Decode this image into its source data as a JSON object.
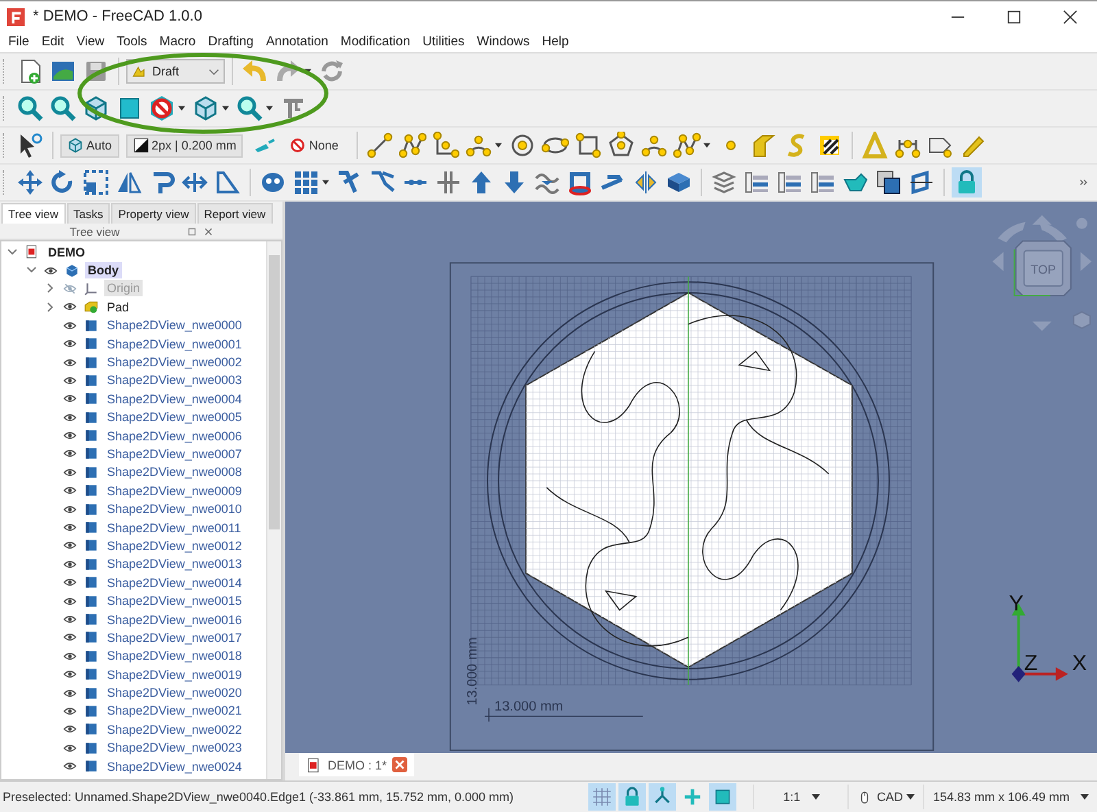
{
  "window": {
    "title": "* DEMO - FreeCAD 1.0.0"
  },
  "menu": [
    "File",
    "Edit",
    "View",
    "Tools",
    "Macro",
    "Drafting",
    "Annotation",
    "Modification",
    "Utilities",
    "Windows",
    "Help"
  ],
  "workbench": {
    "value": "Draft"
  },
  "draft_tray": {
    "construction": "Auto",
    "line_style": "2px | 0.200 mm",
    "autogroup": "None"
  },
  "lock_button": {
    "on": true
  },
  "panel": {
    "tabs": [
      {
        "label": "Tree view",
        "selected": true
      },
      {
        "label": "Tasks",
        "selected": false
      },
      {
        "label": "Property view",
        "selected": false
      },
      {
        "label": "Report view",
        "selected": false
      }
    ],
    "header": "Tree view"
  },
  "tree": {
    "items": [
      {
        "label": "DEMO",
        "kind": "document",
        "selected": false,
        "expanded": true,
        "children": [
          {
            "label": "Body",
            "kind": "body",
            "selected": true,
            "visible": true,
            "expanded": true,
            "children": [
              {
                "label": "Origin",
                "kind": "origin",
                "selected": false,
                "visible": false,
                "expanded": false
              },
              {
                "label": "Pad",
                "kind": "pad",
                "selected": false,
                "visible": true,
                "expanded": false
              },
              {
                "label": "Shape2DView_nwe0000",
                "kind": "shape",
                "selected": false,
                "visible": true
              },
              {
                "label": "Shape2DView_nwe0001",
                "kind": "shape",
                "selected": false,
                "visible": true
              },
              {
                "label": "Shape2DView_nwe0002",
                "kind": "shape",
                "selected": false,
                "visible": true
              },
              {
                "label": "Shape2DView_nwe0003",
                "kind": "shape",
                "selected": false,
                "visible": true
              },
              {
                "label": "Shape2DView_nwe0004",
                "kind": "shape",
                "selected": false,
                "visible": true
              },
              {
                "label": "Shape2DView_nwe0005",
                "kind": "shape",
                "selected": false,
                "visible": true
              },
              {
                "label": "Shape2DView_nwe0006",
                "kind": "shape",
                "selected": false,
                "visible": true
              },
              {
                "label": "Shape2DView_nwe0007",
                "kind": "shape",
                "selected": false,
                "visible": true
              },
              {
                "label": "Shape2DView_nwe0008",
                "kind": "shape",
                "selected": false,
                "visible": true
              },
              {
                "label": "Shape2DView_nwe0009",
                "kind": "shape",
                "selected": false,
                "visible": true
              },
              {
                "label": "Shape2DView_nwe0010",
                "kind": "shape",
                "selected": false,
                "visible": true
              },
              {
                "label": "Shape2DView_nwe0011",
                "kind": "shape",
                "selected": false,
                "visible": true
              },
              {
                "label": "Shape2DView_nwe0012",
                "kind": "shape",
                "selected": false,
                "visible": true
              },
              {
                "label": "Shape2DView_nwe0013",
                "kind": "shape",
                "selected": false,
                "visible": true
              },
              {
                "label": "Shape2DView_nwe0014",
                "kind": "shape",
                "selected": false,
                "visible": true
              },
              {
                "label": "Shape2DView_nwe0015",
                "kind": "shape",
                "selected": false,
                "visible": true
              },
              {
                "label": "Shape2DView_nwe0016",
                "kind": "shape",
                "selected": false,
                "visible": true
              },
              {
                "label": "Shape2DView_nwe0017",
                "kind": "shape",
                "selected": false,
                "visible": true
              },
              {
                "label": "Shape2DView_nwe0018",
                "kind": "shape",
                "selected": false,
                "visible": true
              },
              {
                "label": "Shape2DView_nwe0019",
                "kind": "shape",
                "selected": false,
                "visible": true
              },
              {
                "label": "Shape2DView_nwe0020",
                "kind": "shape",
                "selected": false,
                "visible": true
              },
              {
                "label": "Shape2DView_nwe0021",
                "kind": "shape",
                "selected": false,
                "visible": true
              },
              {
                "label": "Shape2DView_nwe0022",
                "kind": "shape",
                "selected": false,
                "visible": true
              },
              {
                "label": "Shape2DView_nwe0023",
                "kind": "shape",
                "selected": false,
                "visible": true
              },
              {
                "label": "Shape2DView_nwe0024",
                "kind": "shape",
                "selected": false,
                "visible": true
              }
            ]
          }
        ]
      }
    ]
  },
  "view": {
    "navigation_cube": {
      "face": "TOP"
    },
    "dimensions": {
      "horizontal": "13.000 mm",
      "vertical": "13.000 mm"
    },
    "axes": {
      "x": "X",
      "y": "Y",
      "z": "Z"
    }
  },
  "document_tabs": [
    {
      "label": "DEMO : 1*",
      "selected": true
    }
  ],
  "status_bar": {
    "message": "Preselected: Unnamed.Shape2DView_nwe0040.Edge1 (-33.861 mm, 15.752 mm, 0.000 mm)",
    "toggles": [
      {
        "kind": "grid",
        "on": true
      },
      {
        "kind": "lock",
        "on": true
      },
      {
        "kind": "snap",
        "on": true
      },
      {
        "kind": "plus",
        "on": false
      },
      {
        "kind": "square",
        "on": true
      }
    ],
    "scale": "1:1",
    "navigation": "CAD",
    "size": "154.83 mm x 106.49 mm"
  }
}
